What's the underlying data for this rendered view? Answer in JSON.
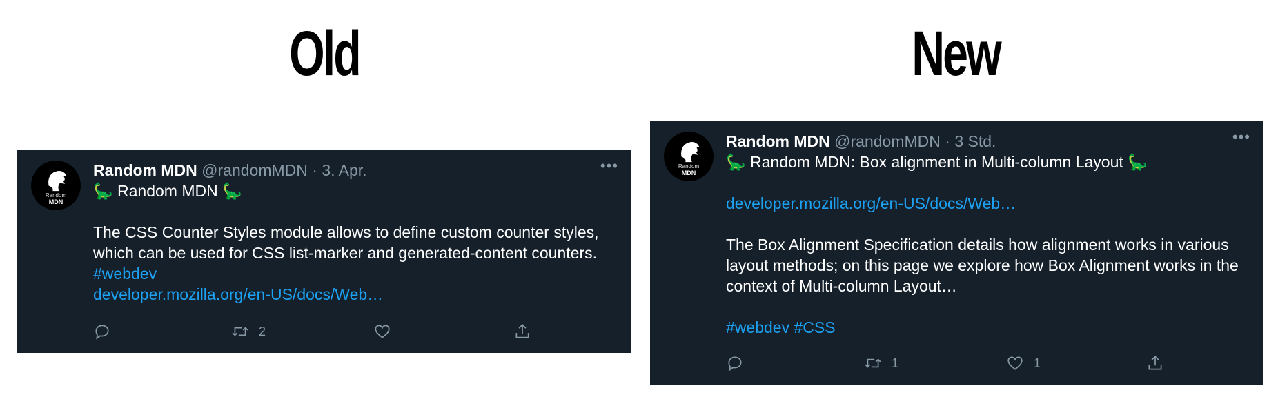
{
  "headings": {
    "old": "Old",
    "new": "New"
  },
  "old_tweet": {
    "display_name": "Random MDN",
    "meta": "@randomMDN · 3. Apr.",
    "more_label": "•••",
    "avatar": {
      "line1": "Random",
      "line2": "MDN"
    },
    "title": "🦕 Random MDN 🦕",
    "body": [
      "The CSS Counter Styles module allows to define custom counter styles,",
      "which can be used for CSS list-marker and generated-content counters."
    ],
    "hashtags": "#webdev",
    "link": "developer.mozilla.org/en-US/docs/Web…",
    "actions": {
      "reply_count": "",
      "retweet_count": "2",
      "like_count": ""
    }
  },
  "new_tweet": {
    "display_name": "Random MDN",
    "meta": "@randomMDN · 3 Std.",
    "more_label": "•••",
    "avatar": {
      "line1": "Random",
      "line2": "MDN"
    },
    "title": "🦕 Random MDN: Box alignment in Multi-column Layout 🦕",
    "link": "developer.mozilla.org/en-US/docs/Web…",
    "body": [
      "The Box Alignment Specification details how alignment works in various",
      "layout methods; on this page we explore how Box Alignment works in the",
      "context of Multi-column Layout…"
    ],
    "hashtags": "#webdev #CSS",
    "actions": {
      "reply_count": "",
      "retweet_count": "1",
      "like_count": "1"
    }
  },
  "icons": [
    "reply-icon",
    "retweet-icon",
    "like-icon",
    "share-icon",
    "more-icon",
    "mdn-lion-logo"
  ],
  "colors": {
    "tweet_bg": "#15202b",
    "link": "#1da1f2",
    "muted": "#8899a6"
  }
}
